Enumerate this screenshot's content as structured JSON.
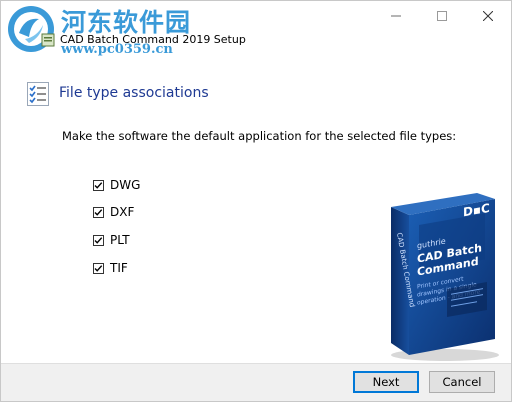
{
  "window": {
    "title": "CAD Batch Command 2019 Setup",
    "controls": {
      "minimize": "minimize-icon",
      "maximize": "maximize-icon",
      "close": "close-icon"
    }
  },
  "watermark": {
    "line1": "河东软件园",
    "line2": "www.pc0359.cn"
  },
  "page": {
    "heading": "File type associations",
    "instruction": "Make the software the default application for the selected file types:"
  },
  "file_types": [
    {
      "label": "DWG",
      "checked": true
    },
    {
      "label": "DXF",
      "checked": true
    },
    {
      "label": "PLT",
      "checked": true
    },
    {
      "label": "TIF",
      "checked": true
    }
  ],
  "product_box": {
    "brand": "guthrie",
    "name_line1": "CAD Batch",
    "name_line2": "Command",
    "tagline_line1": "Print or convert",
    "tagline_line2": "drawings in a single",
    "tagline_line3": "operation - and more",
    "spine": "CAD Batch Command"
  },
  "buttons": {
    "next": "Next",
    "cancel": "Cancel"
  },
  "colors": {
    "heading": "#1f3a93",
    "watermark": "#3a9ad8",
    "box_blue": "#0f3f8a"
  }
}
